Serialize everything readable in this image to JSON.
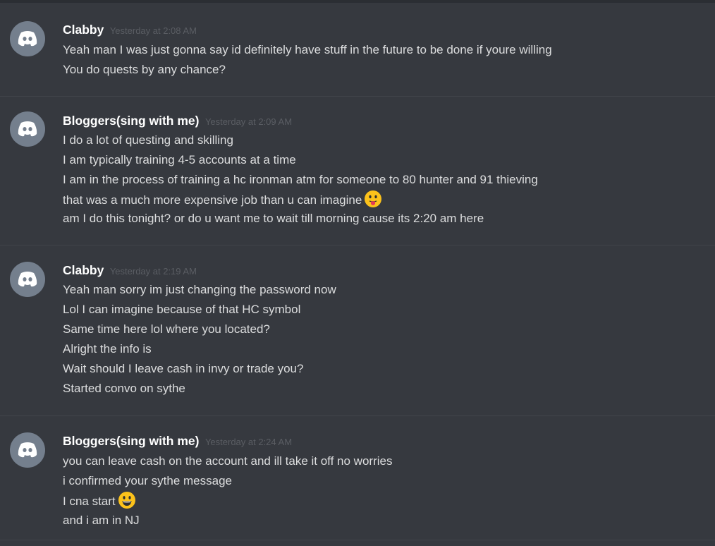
{
  "messages": [
    {
      "author": "Clabby",
      "timestamp": "Yesterday at 2:08 AM",
      "lines": [
        "Yeah man I was just gonna say id definitely have stuff in the future to be done if youre willing",
        "You do quests by any chance?"
      ]
    },
    {
      "author": "Bloggers(sing with me)",
      "timestamp": "Yesterday at 2:09 AM",
      "lines": [
        "I do a lot of questing and skilling",
        "I am typically training 4-5 accounts at a time",
        "I am in the process of training a hc  ironman atm for someone to 80 hunter and 91 thieving",
        "that was a much more expensive job than u can imagine",
        "am I do this tonight? or do u want me to wait till morning cause its 2:20 am here"
      ]
    },
    {
      "author": "Clabby",
      "timestamp": "Yesterday at 2:19 AM",
      "lines": [
        "Yeah man sorry im just changing the password now",
        "Lol I can imagine because of that HC symbol",
        "Same time here lol where you located?",
        "Alright the info is",
        "Wait should I leave cash in invy or trade you?",
        "Started convo on sythe"
      ]
    },
    {
      "author": "Bloggers(sing with me)",
      "timestamp": "Yesterday at 2:24 AM",
      "lines": [
        "you can leave cash on the account and ill take it off no worries",
        "i confirmed your sythe message",
        "I cna start",
        "and i am in NJ"
      ]
    }
  ],
  "icons": {
    "avatar": "discord-logo-icon",
    "emoji_tongue": "face-with-tongue-emoji",
    "emoji_smile": "grinning-face-emoji"
  },
  "colors": {
    "background": "#36393f",
    "username": "#ffffff",
    "text": "#dcddde",
    "timestamp": "#5a5d63",
    "avatar_bg": "#747f8d",
    "divider": "#41444a"
  }
}
